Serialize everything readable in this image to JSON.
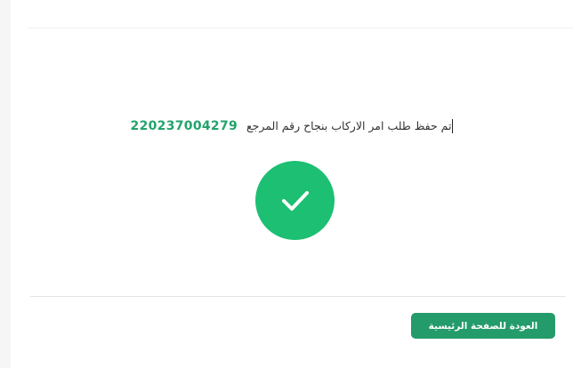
{
  "confirmation": {
    "message": "تم حفظ طلب امر الاركاب بنجاح رقم المرجع",
    "reference_number": "220237004279"
  },
  "icons": {
    "status": "check-icon"
  },
  "colors": {
    "success": "#1dbf72",
    "reference": "#22a36b",
    "button": "#239b6a"
  },
  "actions": {
    "home_label": "العودة للصفحة الرئيسية"
  }
}
